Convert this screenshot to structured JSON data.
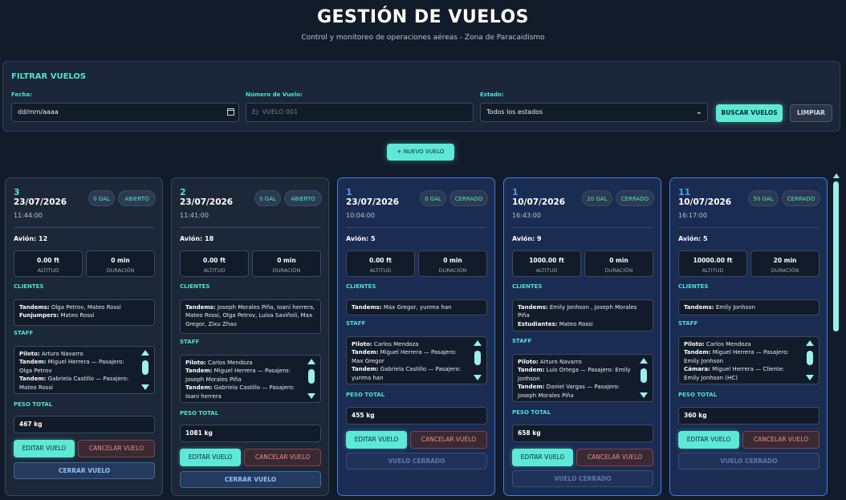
{
  "header": {
    "title": "GESTIÓN DE VUELOS",
    "subtitle": "Control y monitoreo de operaciones aéreas - Zona de Paracaidismo"
  },
  "filters": {
    "title": "FILTRAR VUELOS",
    "date_label": "Fecha:",
    "date_value": "dd/mm/aaaa",
    "flight_label": "Número de Vuelo:",
    "flight_placeholder": "Ej: VUELO 001",
    "status_label": "Estado:",
    "status_value": "Todos los estados",
    "search_button": "BUSCAR VUELOS",
    "clear_button": "LIMPIAR"
  },
  "new_flight_button": "+ NUEVO VUELO",
  "labels": {
    "plane_prefix": "Avión:",
    "altitude": "ALTITUD",
    "duration": "DURACIÓN",
    "clients": "CLIENTES",
    "staff": "STAFF",
    "total_weight": "PESO TOTAL",
    "edit": "EDITAR VUELO",
    "cancel": "CANCELAR VUELO",
    "close": "CERRAR VUELO",
    "closed": "VUELO CERRADO"
  },
  "flights": [
    {
      "id": "3",
      "date": "23/07/2026",
      "time": "11:44:00",
      "fuel": "0 GAL",
      "status": "ABIERTO",
      "plane": "Avión: 12",
      "altitude": "0.00 ft",
      "duration": "0 min",
      "clients": [
        [
          "Tandems:",
          " Olga Petrov, Mateo Rossi"
        ],
        [
          "Funjumpers:",
          " Mateo Rossi"
        ]
      ],
      "staff": [
        [
          "Piloto:",
          " Arturo Navarro"
        ],
        [
          "Tandem:",
          " Miguel Herrera — Pasajero: Olga Petrov"
        ],
        [
          "Tandem:",
          " Gabriela Castillo — Pasajero: Mateo Rossi"
        ]
      ],
      "weight": "467 kg"
    },
    {
      "id": "2",
      "date": "23/07/2026",
      "time": "11:41:00",
      "fuel": "0 GAL",
      "status": "ABIERTO",
      "plane": "Avión: 18",
      "altitude": "0.00 ft",
      "duration": "0 min",
      "clients": [
        [
          "Tandems:",
          " Joseph Morales Piña, Ioani herrera, Mateo Rossi, Olga Petrov, Luisa Saviñoli, Max Gregor, Zixu Zhao"
        ]
      ],
      "staff": [
        [
          "Piloto:",
          " Carlos Mendoza"
        ],
        [
          "Tandem:",
          " Miguel Herrera — Pasajero: Joseph Morales Piña"
        ],
        [
          "Tandem:",
          " Gabriela Castillo — Pasajero: Ioani herrera"
        ]
      ],
      "weight": "1081 kg"
    },
    {
      "id": "1",
      "date": "23/07/2026",
      "time": "10:04:00",
      "fuel": "0 GAL",
      "status": "CERRADO",
      "plane": "Avión: 5",
      "altitude": "0.00 ft",
      "duration": "0 min",
      "clients": [
        [
          "Tandems:",
          " Max Gregor, yunma han"
        ]
      ],
      "staff": [
        [
          "Piloto:",
          " Carlos Mendoza"
        ],
        [
          "Tandem:",
          " Miguel Herrera — Pasajero: Max Gregor"
        ],
        [
          "Tandem:",
          " Gabriela Castillo — Pasajero: yunma han"
        ]
      ],
      "weight": "455 kg"
    },
    {
      "id": "1",
      "date": "10/07/2026",
      "time": "16:43:00",
      "fuel": "20 GAL",
      "status": "CERRADO",
      "plane": "Avión: 9",
      "altitude": "1000.00 ft",
      "duration": "0 min",
      "clients": [
        [
          "Tandems:",
          " Emily Jonhson , Joseph Morales Piña"
        ],
        [
          "Estudiantes:",
          " Mateo Rossi"
        ]
      ],
      "staff": [
        [
          "Piloto:",
          " Arturo Navarro"
        ],
        [
          "Tandem:",
          " Luis Ortega — Pasajero: Emily Jonhson"
        ],
        [
          "Tandem:",
          " Daniel Vargas — Pasajero: Joseph Morales Piña"
        ]
      ],
      "weight": "658 kg"
    },
    {
      "id": "11",
      "date": "10/07/2026",
      "time": "16:17:00",
      "fuel": "50 GAL",
      "status": "CERRADO",
      "plane": "Avión: 5",
      "altitude": "10000.00 ft",
      "duration": "20 min",
      "clients": [
        [
          "Tandems:",
          " Emily Jonhson"
        ]
      ],
      "staff": [
        [
          "Piloto:",
          " Carlos Mendoza"
        ],
        [
          "Tandem:",
          " Miguel Herrera — Pasajero: Emily Jonhson"
        ],
        [
          "Cámara:",
          " Miguel Herrera — Cliente: Emily Jonhson (HC)"
        ]
      ],
      "weight": "360 kg"
    }
  ]
}
